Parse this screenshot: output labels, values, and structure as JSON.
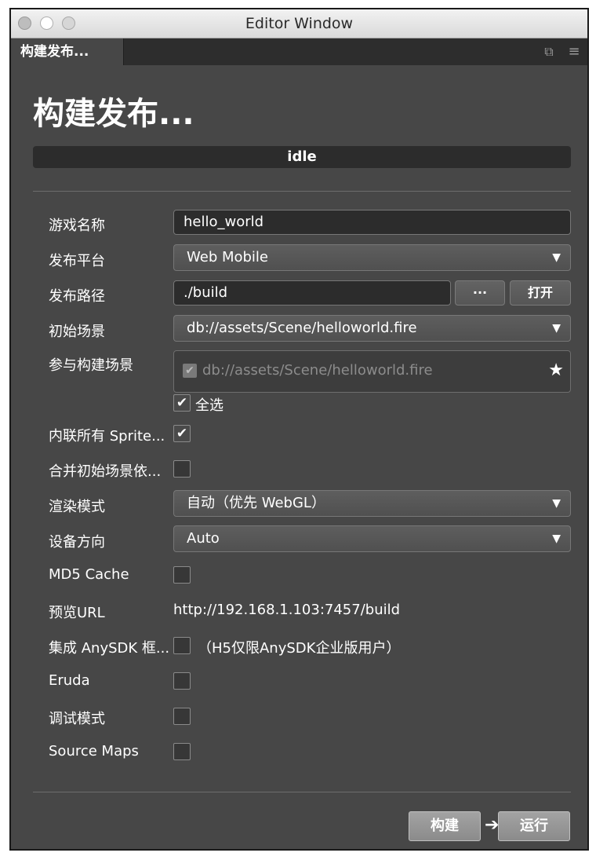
{
  "window": {
    "title": "Editor Window"
  },
  "tab": {
    "label": "构建发布...",
    "icons": [
      "popout-icon",
      "menu-icon"
    ]
  },
  "panel": {
    "title": "构建发布...",
    "status": "idle"
  },
  "form": {
    "game_name": {
      "label": "游戏名称",
      "value": "hello_world"
    },
    "platform": {
      "label": "发布平台",
      "value": "Web Mobile"
    },
    "build_path": {
      "label": "发布路径",
      "value": "./build",
      "browse_label": "···",
      "open_label": "打开"
    },
    "start_scene": {
      "label": "初始场景",
      "value": "db://assets/Scene/helloworld.fire"
    },
    "included_scenes": {
      "label": "参与构建场景",
      "items": [
        {
          "path": "db://assets/Scene/helloworld.fire",
          "checked": true
        }
      ],
      "select_all_label": "全选",
      "select_all_checked": true
    },
    "inline_sprite": {
      "label": "内联所有 Sprite...",
      "checked": true
    },
    "merge_start_scene": {
      "label": "合并初始场景依...",
      "checked": false
    },
    "render_mode": {
      "label": "渲染模式",
      "value": "自动（优先 WebGL）"
    },
    "orientation": {
      "label": "设备方向",
      "value": "Auto"
    },
    "md5_cache": {
      "label": "MD5 Cache",
      "checked": false
    },
    "preview_url": {
      "label": "预览URL",
      "value": "http://192.168.1.103:7457/build"
    },
    "anysdk": {
      "label": "集成 AnySDK 框...",
      "checked": false,
      "note": "（H5仅限AnySDK企业版用户）"
    },
    "eruda": {
      "label": "Eruda",
      "checked": false
    },
    "debug_mode": {
      "label": "调试模式",
      "checked": false
    },
    "source_maps": {
      "label": "Source Maps",
      "checked": false
    }
  },
  "actions": {
    "build_label": "构建",
    "arrow": "➔",
    "run_label": "运行"
  },
  "glyphs": {
    "dropdown": "▼",
    "check": "✔",
    "star": "★"
  }
}
